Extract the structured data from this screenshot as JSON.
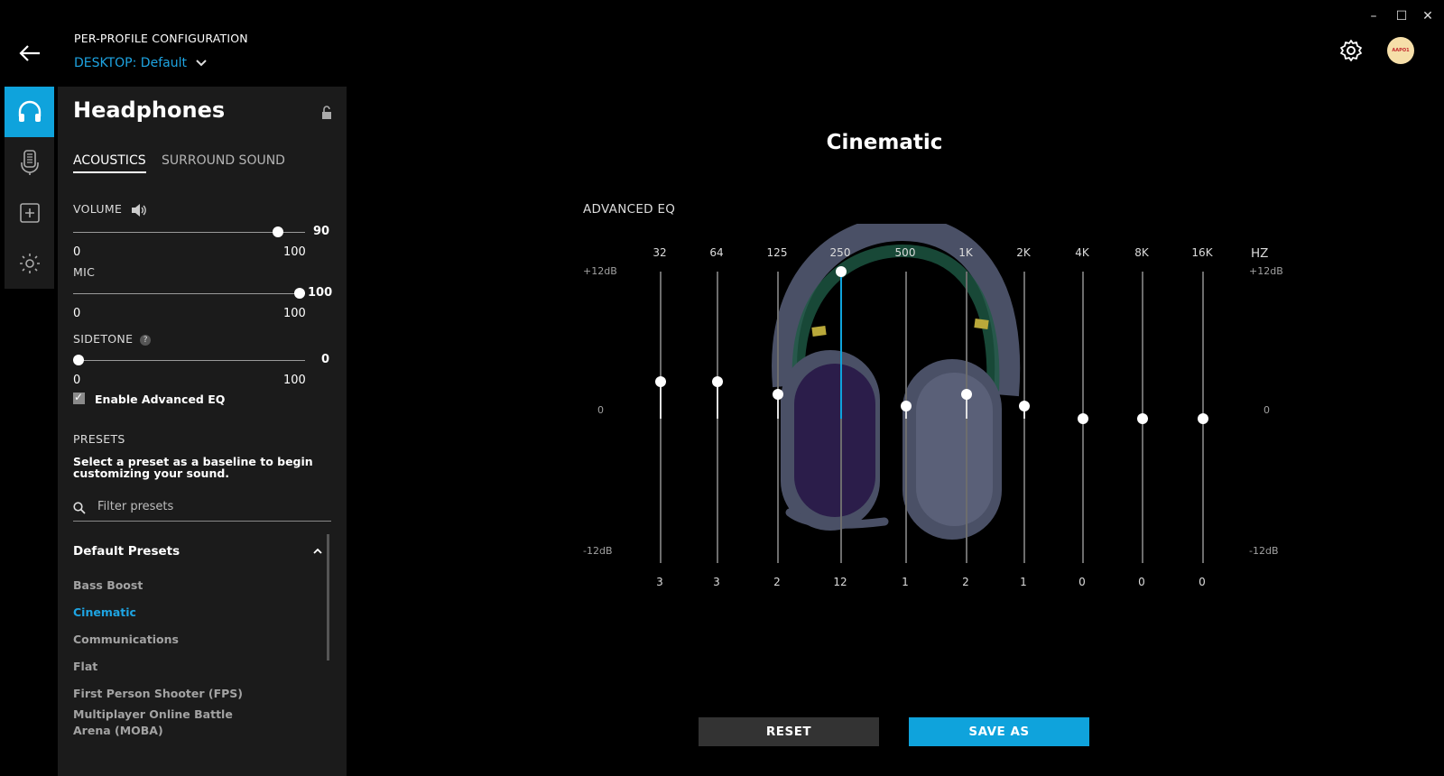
{
  "window": {
    "minimize": "–",
    "maximize": "☐",
    "close": "✕"
  },
  "header": {
    "config_label": "PER-PROFILE CONFIGURATION",
    "profile_prefix": "DESKTOP:",
    "profile_name": "Default",
    "avatar_text": "AAPO1"
  },
  "rail": [
    "headphones-icon",
    "mic-icon",
    "add-icon",
    "lighting-icon"
  ],
  "panel": {
    "title": "Headphones",
    "tabs": [
      "ACOUSTICS",
      "SURROUND SOUND"
    ],
    "volume": {
      "label": "VOLUME",
      "value": 90,
      "min": "0",
      "max": "100",
      "display": "90"
    },
    "mic": {
      "label": "MIC",
      "value": 100,
      "min": "0",
      "max": "100",
      "display": "100"
    },
    "sidetone": {
      "label": "SIDETONE",
      "help": "?",
      "value": 0,
      "min": "0",
      "max": "100",
      "display": "0"
    },
    "advanced_eq": {
      "label": "Enable Advanced EQ",
      "checked": true,
      "check": "✓"
    },
    "presets": {
      "heading": "PRESETS",
      "description": "Select a preset as a baseline to begin customizing your sound.",
      "search_placeholder": "Filter presets",
      "group": "Default Presets",
      "items": [
        {
          "label": "Bass Boost",
          "active": false
        },
        {
          "label": "Cinematic",
          "active": true
        },
        {
          "label": "Communications",
          "active": false
        },
        {
          "label": "Flat",
          "active": false
        },
        {
          "label": "First Person Shooter (FPS)",
          "active": false
        },
        {
          "label": "Multiplayer Online Battle Arena (MOBA)",
          "active": false
        }
      ]
    }
  },
  "eq": {
    "preset_title": "Cinematic",
    "label": "ADVANCED EQ",
    "unit": "HZ",
    "max_label": "+12dB",
    "zero_label": "0",
    "min_label": "-12dB",
    "range": [
      -12,
      12
    ],
    "bands": [
      {
        "freq": "32",
        "value": 3,
        "display": "3"
      },
      {
        "freq": "64",
        "value": 3,
        "display": "3"
      },
      {
        "freq": "125",
        "value": 2,
        "display": "2"
      },
      {
        "freq": "250",
        "value": 12,
        "display": "12",
        "selected": true
      },
      {
        "freq": "500",
        "value": 1,
        "display": "1"
      },
      {
        "freq": "1K",
        "value": 2,
        "display": "2"
      },
      {
        "freq": "2K",
        "value": 1,
        "display": "1"
      },
      {
        "freq": "4K",
        "value": 0,
        "display": "0"
      },
      {
        "freq": "8K",
        "value": 0,
        "display": "0"
      },
      {
        "freq": "16K",
        "value": 0,
        "display": "0"
      }
    ],
    "accent": "#0fa3dc"
  },
  "actions": {
    "reset": "RESET",
    "save_as": "SAVE AS"
  }
}
